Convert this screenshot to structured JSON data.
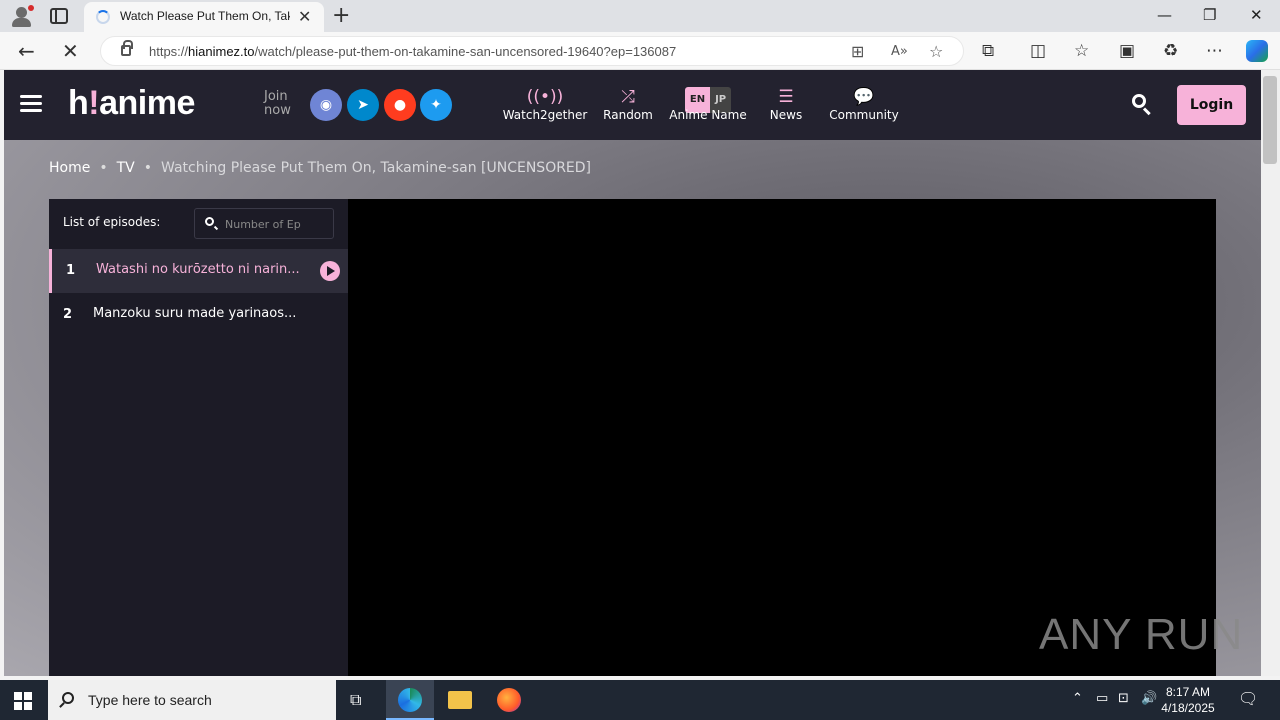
{
  "browser": {
    "tab_title": "Watch Please Put Them On, Takamine-san [UNCENSORED]",
    "url_prefix": "https://",
    "url_domain": "hianimez.to",
    "url_path": "/watch/please-put-them-on-takamine-san-uncensored-19640?ep=136087"
  },
  "site": {
    "logo_prefix": "h",
    "logo_bang": "!",
    "logo_suffix": "anime",
    "join_label": "Join now",
    "nav": [
      {
        "label": "Watch2gether",
        "icon": "broadcast-icon"
      },
      {
        "label": "Random",
        "icon": "shuffle-icon"
      },
      {
        "label": "Anime Name",
        "icon": "language-toggle"
      },
      {
        "label": "News",
        "icon": "rss-icon"
      },
      {
        "label": "Community",
        "icon": "chat-icon"
      }
    ],
    "lang_en": "EN",
    "lang_jp": "JP",
    "login_label": "Login",
    "social": [
      {
        "name": "discord",
        "color": "#6f85d5"
      },
      {
        "name": "telegram",
        "color": "#0088cc"
      },
      {
        "name": "reddit",
        "color": "#ff3c1f"
      },
      {
        "name": "twitter",
        "color": "#1d9bf0"
      }
    ],
    "accent_color": "#f7b2d9"
  },
  "breadcrumb": {
    "home": "Home",
    "category": "TV",
    "current": "Watching Please Put Them On, Takamine-san [UNCENSORED]"
  },
  "episodes": {
    "heading": "List of episodes:",
    "search_placeholder": "Number of Ep",
    "items": [
      {
        "number": "1",
        "title": "Watashi no kurōzetto ni narin...",
        "active": true
      },
      {
        "number": "2",
        "title": "Manzoku suru made yarinaos...",
        "active": false
      }
    ]
  },
  "watermark": "ANY RUN",
  "taskbar": {
    "search_text": "Type here to search",
    "time": "8:17 AM",
    "date": "4/18/2025"
  }
}
